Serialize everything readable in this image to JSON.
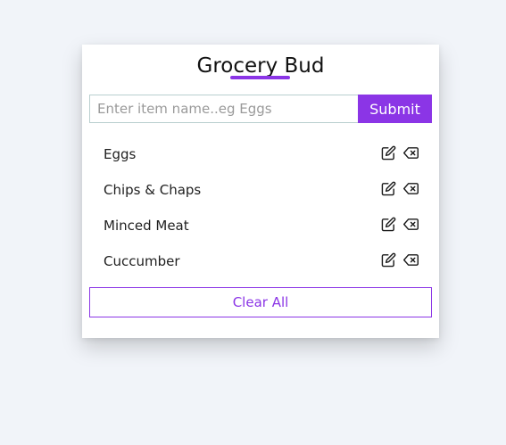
{
  "app": {
    "title": "Grocery Bud"
  },
  "form": {
    "placeholder": "Enter item name..eg Eggs",
    "value": "",
    "submit_label": "Submit"
  },
  "items": [
    {
      "name": "Eggs"
    },
    {
      "name": "Chips & Chaps"
    },
    {
      "name": "Minced Meat"
    },
    {
      "name": "Cuccumber"
    }
  ],
  "clear_label": "Clear All",
  "colors": {
    "accent": "#8b35e6",
    "background": "#f1f4f9",
    "card": "#ffffff"
  },
  "icons": {
    "edit": "edit-icon",
    "delete": "delete-icon"
  }
}
